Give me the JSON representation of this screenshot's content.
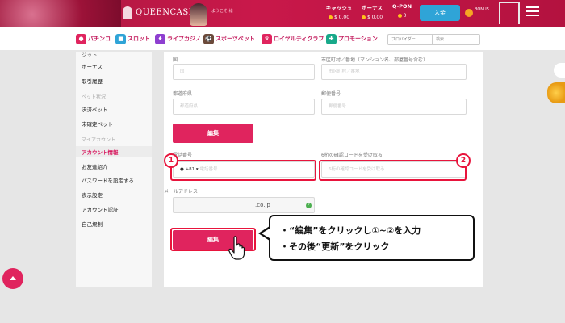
{
  "header": {
    "logo": "QUEENCASINO",
    "welcome": "ようこそ 様",
    "balances": [
      {
        "label": "キャッシュ",
        "value": "$ 0.00"
      },
      {
        "label": "ボーナス",
        "value": "$ 0.00"
      },
      {
        "label": "Q-PON",
        "value": "0"
      }
    ],
    "deposit_label": "入金",
    "bonus_badge": "BONUS"
  },
  "nav": {
    "items": [
      {
        "label": "パチンコ",
        "color": "#e0245e"
      },
      {
        "label": "スロット",
        "color": "#2fa4d7"
      },
      {
        "label": "ライブカジノ",
        "color": "#8e3fd0"
      },
      {
        "label": "スポーツベット",
        "color": "#e0245e"
      },
      {
        "label": "ロイヤルティクラブ",
        "color": "#e0245e"
      },
      {
        "label": "プロモーション",
        "color": "#18a98a"
      }
    ],
    "provider_placeholder": "プロバイダー",
    "search_placeholder": "検索"
  },
  "sidebar": {
    "top_cut": "ジット",
    "items_a": [
      "ボーナス",
      "取引履歴"
    ],
    "section_bet": "ベット状況",
    "items_b": [
      "決済ベット",
      "未確定ベット"
    ],
    "section_account": "マイアカウント",
    "items_c": [
      "アカウント情報",
      "お友達紹介",
      "パスワードを設定する",
      "表示設定",
      "アカウント認証",
      "自己規制"
    ]
  },
  "form": {
    "country_label": "国",
    "country_placeholder": "国",
    "city_label": "市区町村／番地（マンション名、部屋番号含む）",
    "city_placeholder": "市区町村／番地",
    "prefecture_label": "都道府県",
    "prefecture_placeholder": "都道府県",
    "postal_label": "郵便番号",
    "postal_placeholder": "郵便番号",
    "edit_label": "編集",
    "phone_label": "電話番号",
    "phone_code": "+81",
    "phone_placeholder": "電話番号",
    "sms_label": "6桁の確認コードを受け取る",
    "sms_placeholder": "6桁の確認コードを受け取る",
    "email_label": "メールアドレス",
    "email_value": ".co.jp",
    "edit2_label": "編集"
  },
  "annotation": {
    "num1": "1",
    "num2": "2",
    "line1": "・“編集”をクリックし①~②を入力",
    "line2": "・その後“更新”をクリック"
  }
}
